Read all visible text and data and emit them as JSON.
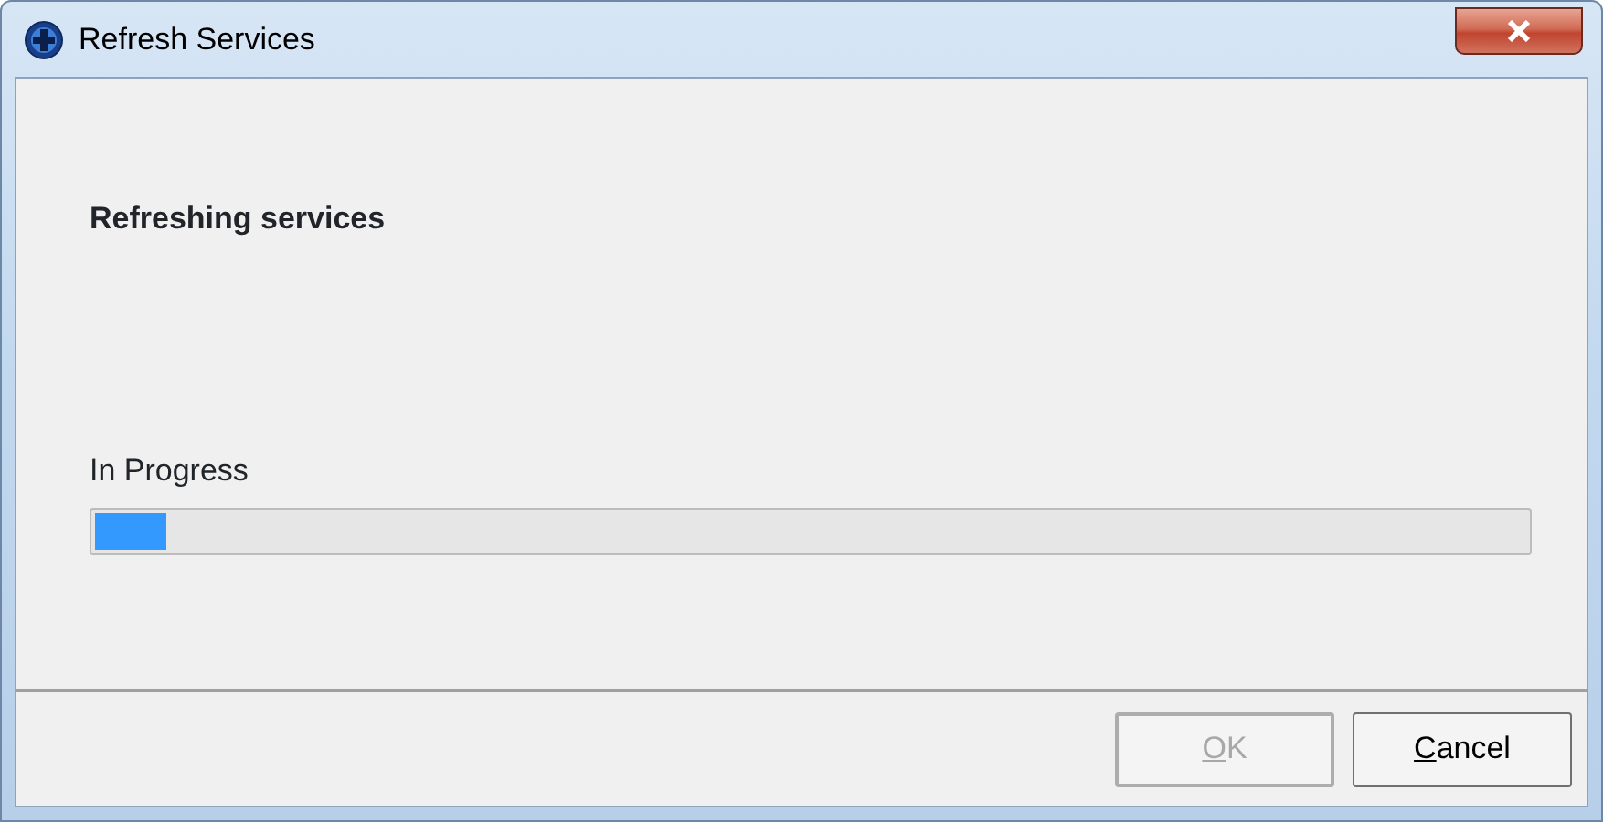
{
  "window": {
    "title": "Refresh Services"
  },
  "heading": "Refreshing services",
  "progress": {
    "label": "In Progress",
    "level": 0.05
  },
  "buttons": [
    {
      "label": "OK",
      "disabled": true,
      "mnemonic": true
    },
    {
      "label": "Cancel",
      "disabled": false,
      "mnemonic": true
    }
  ]
}
